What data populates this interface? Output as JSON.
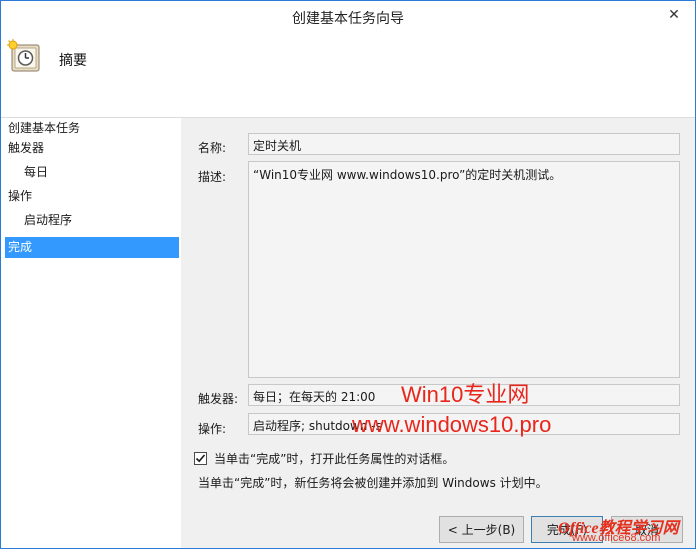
{
  "window": {
    "title": "创建基本任务向导",
    "close_glyph": "✕"
  },
  "header": {
    "title": "摘要",
    "icon": "task-scheduler-clock-icon"
  },
  "sidebar": {
    "items": [
      {
        "label": "创建基本任务",
        "level": 0,
        "active": false
      },
      {
        "label": "触发器",
        "level": 0,
        "active": false
      },
      {
        "label": "每日",
        "level": 1,
        "active": false
      },
      {
        "label": "操作",
        "level": 0,
        "active": false
      },
      {
        "label": "启动程序",
        "level": 1,
        "active": false
      },
      {
        "label": "完成",
        "level": 0,
        "active": true
      }
    ]
  },
  "summary": {
    "name_label": "名称:",
    "name_value": "定时关机",
    "desc_label": "描述:",
    "desc_value": "“Win10专业网 www.windows10.pro”的定时关机测试。",
    "trigger_label": "触发器:",
    "trigger_value": "每日；在每天的 21:00",
    "action_label": "操作:",
    "action_value": "启动程序; shutdown -s"
  },
  "options": {
    "open_properties_label": "当单击“完成”时，打开此任务属性的对话框。",
    "open_properties_checked": true,
    "note": "当单击“完成”时，新任务将会被创建并添加到 Windows 计划中。"
  },
  "buttons": {
    "back": "< 上一步(B)",
    "finish": "完成(F)",
    "cancel": "取消"
  },
  "watermarks": {
    "line1": "Win10专业网",
    "line2": "www.windows10.pro",
    "logo_top": "Office教程学习网",
    "logo_bottom": "www.office68.com"
  },
  "colors": {
    "accent": "#3399ff",
    "watermark": "#e8261c"
  }
}
